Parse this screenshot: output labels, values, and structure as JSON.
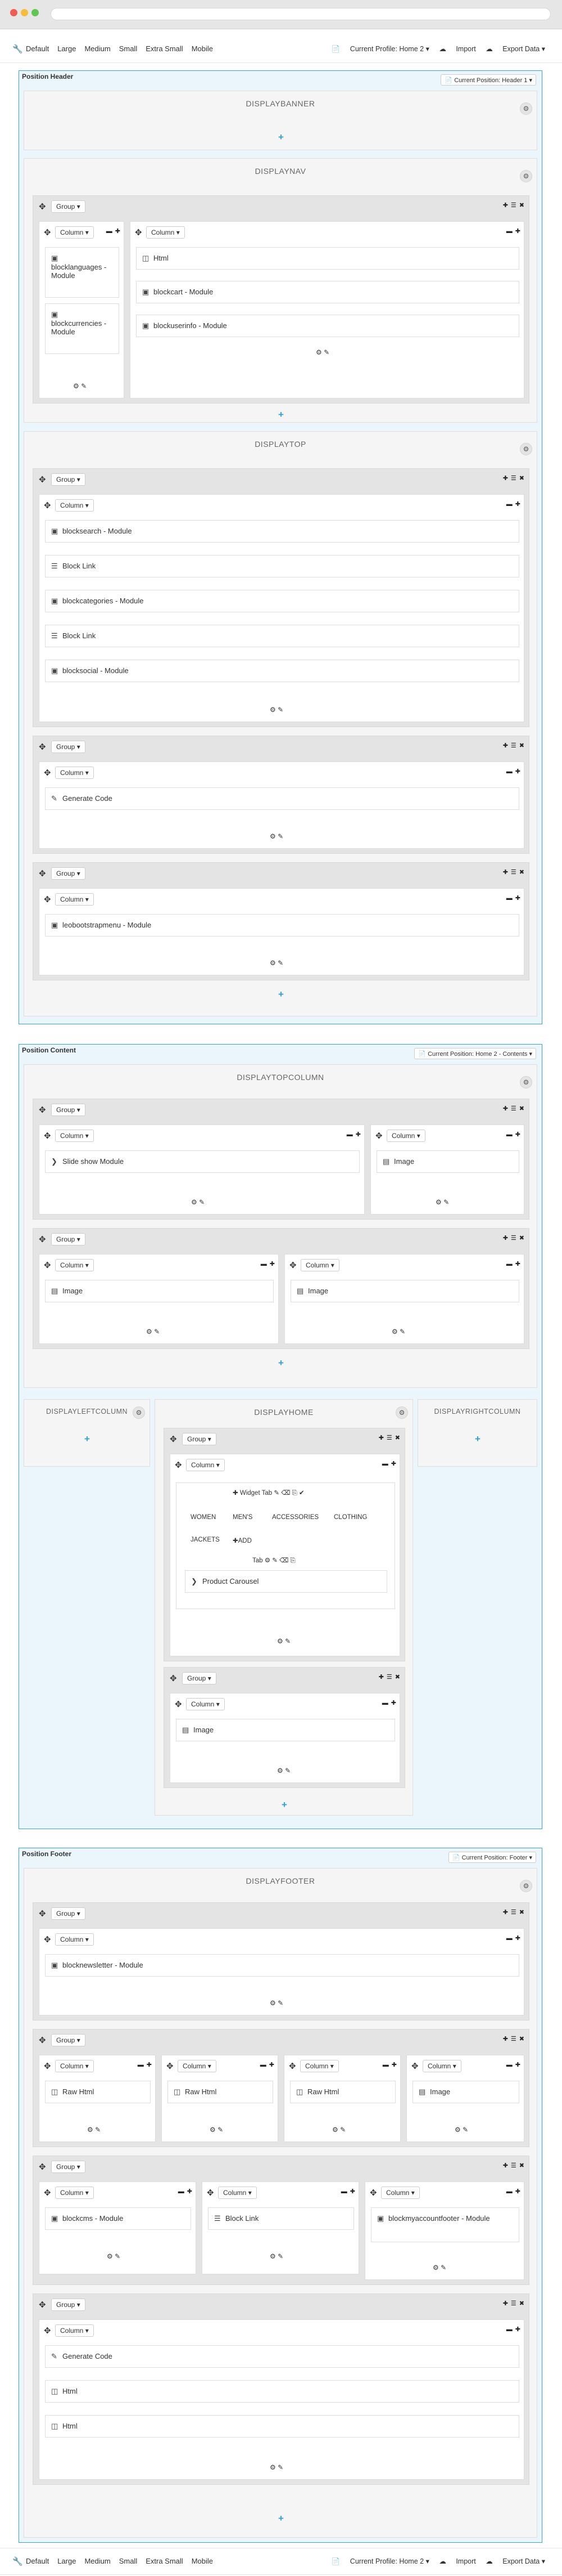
{
  "toolbar": {
    "devices": [
      "Default",
      "Large",
      "Medium",
      "Small",
      "Extra Small",
      "Mobile"
    ],
    "profile": "Current Profile: Home 2",
    "import": "Import",
    "export": "Export Data"
  },
  "header": {
    "title": "Position Header",
    "select": "Current Position: Header 1"
  },
  "content": {
    "title": "Position Content",
    "select": "Current Position: Home 2 - Contents"
  },
  "footer": {
    "title": "Position Footer",
    "select": "Current Position: Footer"
  },
  "labels": {
    "group": "Group",
    "column": "Column"
  },
  "hooks": {
    "banner": "DISPLAYBANNER",
    "nav": "DISPLAYNAV",
    "top": "DISPLAYTOP",
    "topcolumn": "DISPLAYTOPCOLUMN",
    "leftcolumn": "DISPLAYLEFTCOLUMN",
    "home": "DISPLAYHOME",
    "rightcolumn": "DISPLAYRIGHTCOLUMN",
    "footer": "DISPLAYFOOTER"
  },
  "widgets": {
    "nav_left": [
      "blocklanguages - Module",
      "blockcurrencies - Module"
    ],
    "nav_right": [
      "Html",
      "blockcart - Module",
      "blockuserinfo - Module"
    ],
    "top1": [
      "blocksearch - Module",
      "Block Link",
      "blockcategories - Module",
      "Block Link",
      "blocksocial - Module"
    ],
    "top2": [
      "Generate Code"
    ],
    "top3": [
      "leobootstrapmenu - Module"
    ],
    "tc1a": "Slide show Module",
    "tc1b": "Image",
    "tc2a": "Image",
    "tc2b": "Image",
    "home_tab_title": "Widget Tab",
    "home_tabs": [
      "WOMEN",
      "MEN'S",
      "ACCESSORIES",
      "CLOTHING",
      "JACKETS"
    ],
    "home_add": "ADD",
    "home_tab": "Tab",
    "home_carousel": "Product Carousel",
    "home_img": "Image",
    "f1": "blocknewsletter - Module",
    "f2": [
      "Raw Html",
      "Raw Html",
      "Raw Html",
      "Image"
    ],
    "f3": [
      "blockcms - Module",
      "Block Link",
      "blockmyaccountfooter - Module"
    ],
    "f4": [
      "Generate Code",
      "Html",
      "Html"
    ]
  },
  "icons": {
    "wrench": "wrench-icon",
    "move": "move-icon",
    "gear": "gear-icon",
    "plus": "plus-icon",
    "edit": "pencil-icon",
    "module": "module-icon",
    "html": "html5-icon",
    "link": "list-icon",
    "image": "image-icon",
    "code": "edit-code-icon",
    "chevron": "chevron-right-icon"
  }
}
